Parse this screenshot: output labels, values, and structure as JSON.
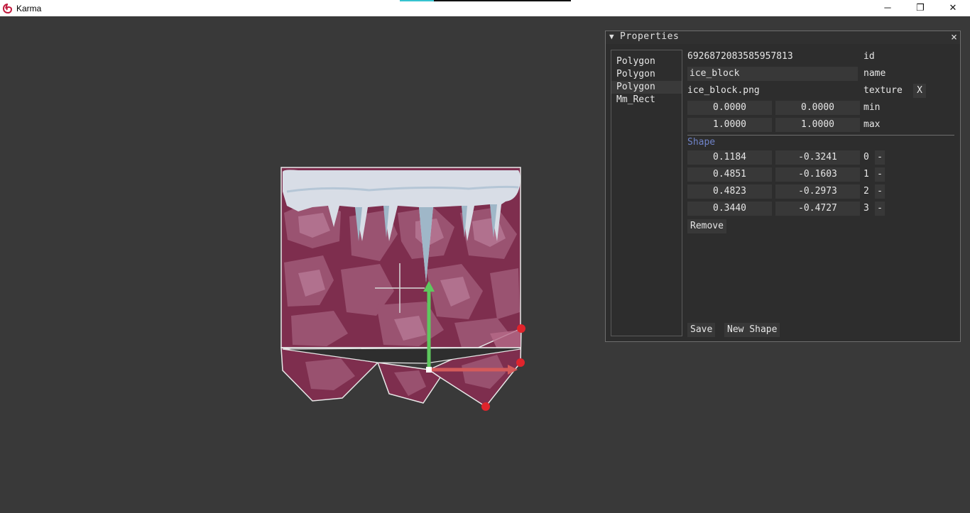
{
  "window": {
    "title": "Karma",
    "minimize_glyph": "─",
    "maximize_glyph": "❐",
    "close_glyph": "✕",
    "accent": "#c0193c"
  },
  "panel": {
    "arrow_glyph": "▼",
    "title": "Properties",
    "close_glyph": "×",
    "entities": [
      "Polygon",
      "Polygon",
      "Polygon",
      "Mm_Rect"
    ],
    "selected_entity_index": 2,
    "fields": {
      "id_value": "6926872083585957813",
      "id_label": "id",
      "name_value": "ice_block",
      "name_label": "name",
      "texture_value": "ice_block.png",
      "texture_label": "texture",
      "texture_clear": "X",
      "min_x": "0.0000",
      "min_y": "0.0000",
      "min_label": "min",
      "max_x": "1.0000",
      "max_y": "1.0000",
      "max_label": "max"
    },
    "shape_section_label": "Shape",
    "shape_points": [
      {
        "x": "0.1184",
        "y": "-0.3241",
        "index": "0",
        "remove": "-"
      },
      {
        "x": "0.4851",
        "y": "-0.1603",
        "index": "1",
        "remove": "-"
      },
      {
        "x": "0.4823",
        "y": "-0.2973",
        "index": "2",
        "remove": "-"
      },
      {
        "x": "0.3440",
        "y": "-0.4727",
        "index": "3",
        "remove": "-"
      }
    ],
    "remove_label": "Remove",
    "save_label": "Save",
    "new_shape_label": "New Shape"
  },
  "colors": {
    "background": "#393939",
    "panel_bg": "#2d2d2d",
    "section_label": "#6f83c8",
    "gizmo_y": "#5ec85e",
    "gizmo_x": "#d45a5a",
    "handle": "#e0242c",
    "sprite_base": "#7e2e4e",
    "ice": "#d8dde6"
  }
}
